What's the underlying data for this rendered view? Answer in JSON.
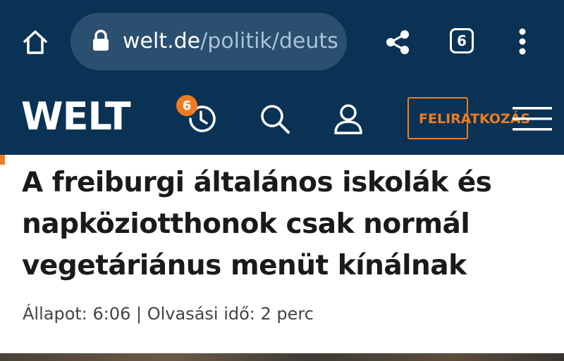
{
  "browser": {
    "url_domain": "welt.de",
    "url_path": "/politik/deuts",
    "tab_count": "6",
    "icons": [
      "home-icon",
      "lock-icon",
      "share-icon",
      "more-vert-icon"
    ]
  },
  "site_header": {
    "logo": "WELT",
    "history_badge": "6",
    "subscribe_label": "FELIRATKOZÁS",
    "icons": [
      "history-clock-icon",
      "search-icon",
      "user-icon",
      "menu-icon"
    ],
    "brand_color": "#0a3255",
    "accent_color": "#ee7c1f"
  },
  "article": {
    "headline": "A freiburgi általános iskolák és napköziotthonok csak normál vegetáriánus menüt kínálnak",
    "meta": "Állapot: 6:06 | Olvasási idő: 2 perc"
  }
}
